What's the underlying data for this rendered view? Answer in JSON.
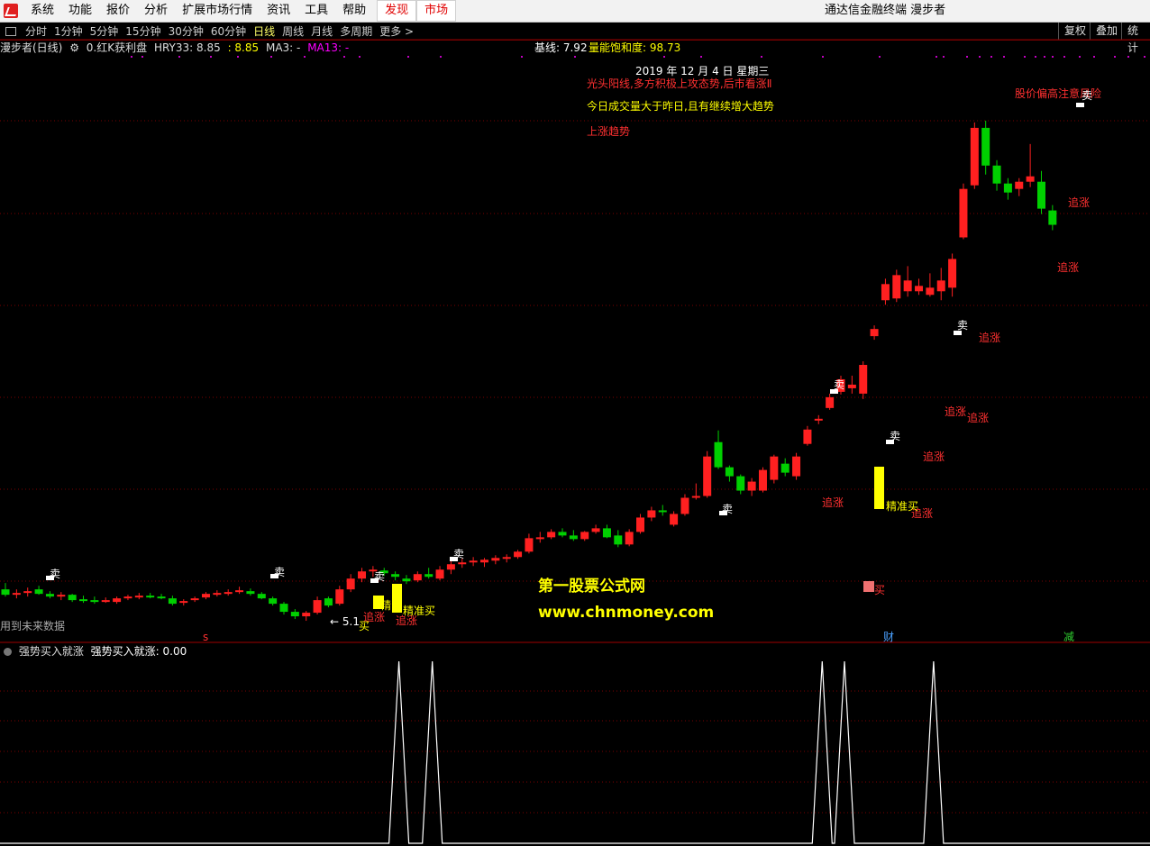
{
  "menu": {
    "items": [
      "系统",
      "功能",
      "报价",
      "分析",
      "扩展市场行情",
      "资讯",
      "工具",
      "帮助"
    ],
    "highlight_items": [
      "发现",
      "市场"
    ],
    "window_title": "通达信金融终端  漫步者"
  },
  "toolbar": {
    "periods": [
      "分时",
      "1分钟",
      "5分钟",
      "15分钟",
      "30分钟",
      "60分钟",
      "日线",
      "周线",
      "月线",
      "多周期",
      "更多 >"
    ],
    "active_period": "日线",
    "right_buttons": [
      "复权",
      "叠加",
      "统计"
    ]
  },
  "chart_header": {
    "stock": "漫步者(日线)",
    "formula": "0.红K获利盘",
    "hry": "HRY33: 8.85",
    "val2": ": 8.85",
    "ma3": "MA3: -",
    "ma13": "MA13: -",
    "base": "基线: 7.92",
    "saturation": "量能饱和度: 98.73"
  },
  "annotations": {
    "date": "2019 年 12 月 4 日 星期三",
    "msg1": "光头阳线,多方积极上攻态势,后市看涨Ⅱ",
    "msg2": "今日成交量大于昨日,且有继续增大趋势",
    "msg3": "上涨趋势",
    "warn": "股价偏高注意风险",
    "future": "用到未来数据",
    "watermark1": "第一股票公式网",
    "watermark2": "www.chnmoney.com",
    "sell": "卖",
    "buy": "买",
    "chase": "追涨",
    "precise_buy": "精准买",
    "jing": "精",
    "arrow_label": "← 5.1",
    "mark_cai": "财",
    "mark_jian": "减",
    "mark_s": "s"
  },
  "sub_header": {
    "label": "强势买入就涨",
    "value": "强势买入就涨: 0.00"
  },
  "colors": {
    "up": "#ff2020",
    "down": "#00d000",
    "grid": "#7a0000",
    "signal": "#ffff00"
  },
  "chart_data": {
    "type": "candlestick",
    "date": "2019-12-04",
    "ohlc": [
      [
        7.38,
        7.45,
        7.3,
        7.32
      ],
      [
        7.33,
        7.38,
        7.28,
        7.34
      ],
      [
        7.34,
        7.4,
        7.3,
        7.36
      ],
      [
        7.38,
        7.42,
        7.32,
        7.33
      ],
      [
        7.33,
        7.36,
        7.28,
        7.3
      ],
      [
        7.31,
        7.35,
        7.26,
        7.32
      ],
      [
        7.32,
        7.33,
        7.24,
        7.26
      ],
      [
        7.27,
        7.31,
        7.23,
        7.26
      ],
      [
        7.26,
        7.3,
        7.22,
        7.24
      ],
      [
        7.25,
        7.29,
        7.23,
        7.26
      ],
      [
        7.24,
        7.3,
        7.22,
        7.28
      ],
      [
        7.28,
        7.32,
        7.26,
        7.3
      ],
      [
        7.3,
        7.34,
        7.27,
        7.31
      ],
      [
        7.31,
        7.34,
        7.28,
        7.29
      ],
      [
        7.3,
        7.33,
        7.27,
        7.28
      ],
      [
        7.28,
        7.31,
        7.2,
        7.22
      ],
      [
        7.23,
        7.27,
        7.2,
        7.25
      ],
      [
        7.26,
        7.3,
        7.24,
        7.28
      ],
      [
        7.29,
        7.35,
        7.27,
        7.33
      ],
      [
        7.33,
        7.37,
        7.3,
        7.34
      ],
      [
        7.34,
        7.38,
        7.31,
        7.35
      ],
      [
        7.35,
        7.41,
        7.33,
        7.37
      ],
      [
        7.36,
        7.39,
        7.31,
        7.33
      ],
      [
        7.33,
        7.35,
        7.27,
        7.28
      ],
      [
        7.28,
        7.3,
        7.2,
        7.22
      ],
      [
        7.22,
        7.24,
        7.1,
        7.13
      ],
      [
        7.13,
        7.16,
        7.05,
        7.08
      ],
      [
        7.08,
        7.14,
        7.03,
        7.12
      ],
      [
        7.12,
        7.3,
        7.1,
        7.26
      ],
      [
        7.28,
        7.3,
        7.18,
        7.2
      ],
      [
        7.22,
        7.42,
        7.2,
        7.38
      ],
      [
        7.38,
        7.55,
        7.35,
        7.5
      ],
      [
        7.5,
        7.62,
        7.46,
        7.58
      ],
      [
        7.58,
        7.64,
        7.52,
        7.6
      ],
      [
        7.59,
        7.62,
        7.53,
        7.56
      ],
      [
        7.55,
        7.58,
        7.48,
        7.52
      ],
      [
        7.5,
        7.54,
        7.44,
        7.47
      ],
      [
        7.48,
        7.58,
        7.46,
        7.55
      ],
      [
        7.55,
        7.62,
        7.5,
        7.52
      ],
      [
        7.5,
        7.64,
        7.48,
        7.6
      ],
      [
        7.6,
        7.7,
        7.55,
        7.66
      ],
      [
        7.66,
        7.72,
        7.62,
        7.68
      ],
      [
        7.68,
        7.74,
        7.64,
        7.7
      ],
      [
        7.68,
        7.73,
        7.63,
        7.71
      ],
      [
        7.7,
        7.76,
        7.66,
        7.73
      ],
      [
        7.72,
        7.77,
        7.68,
        7.74
      ],
      [
        7.74,
        7.82,
        7.72,
        7.8
      ],
      [
        7.8,
        8.0,
        7.78,
        7.95
      ],
      [
        7.95,
        8.02,
        7.9,
        7.96
      ],
      [
        7.96,
        8.05,
        7.94,
        8.02
      ],
      [
        8.02,
        8.06,
        7.96,
        7.98
      ],
      [
        7.98,
        8.04,
        7.92,
        7.94
      ],
      [
        7.94,
        8.03,
        7.92,
        8.02
      ],
      [
        8.02,
        8.1,
        8.0,
        8.06
      ],
      [
        8.06,
        8.1,
        7.95,
        7.96
      ],
      [
        7.98,
        8.04,
        7.85,
        7.88
      ],
      [
        7.88,
        8.05,
        7.86,
        8.02
      ],
      [
        8.02,
        8.22,
        8.0,
        8.18
      ],
      [
        8.18,
        8.3,
        8.14,
        8.26
      ],
      [
        8.26,
        8.32,
        8.2,
        8.24
      ],
      [
        8.1,
        8.25,
        8.08,
        8.22
      ],
      [
        8.22,
        8.44,
        8.2,
        8.4
      ],
      [
        8.41,
        8.56,
        8.38,
        8.42
      ],
      [
        8.42,
        8.92,
        8.4,
        8.86
      ],
      [
        9.02,
        9.15,
        8.72,
        8.74
      ],
      [
        8.74,
        8.76,
        8.58,
        8.64
      ],
      [
        8.64,
        8.66,
        8.44,
        8.48
      ],
      [
        8.48,
        8.62,
        8.42,
        8.58
      ],
      [
        8.48,
        8.74,
        8.46,
        8.71
      ],
      [
        8.6,
        8.88,
        8.56,
        8.86
      ],
      [
        8.78,
        8.84,
        8.64,
        8.68
      ],
      [
        8.64,
        8.9,
        8.6,
        8.86
      ],
      [
        9.0,
        9.2,
        8.98,
        9.16
      ],
      [
        9.26,
        9.32,
        9.22,
        9.28
      ],
      [
        9.4,
        9.56,
        9.38,
        9.52
      ],
      [
        9.58,
        9.76,
        9.55,
        9.72
      ],
      [
        9.62,
        9.76,
        9.56,
        9.66
      ],
      [
        9.56,
        9.92,
        9.5,
        9.88
      ],
      [
        10.2,
        10.32,
        10.16,
        10.28
      ],
      [
        10.6,
        10.84,
        10.55,
        10.78
      ],
      [
        10.62,
        10.94,
        10.58,
        10.88
      ],
      [
        10.7,
        10.98,
        10.64,
        10.82
      ],
      [
        10.7,
        10.84,
        10.66,
        10.76
      ],
      [
        10.66,
        10.9,
        10.64,
        10.74
      ],
      [
        10.7,
        10.96,
        10.6,
        10.82
      ],
      [
        10.74,
        11.12,
        10.64,
        11.06
      ],
      [
        11.3,
        11.9,
        11.28,
        11.84
      ],
      [
        11.88,
        12.58,
        11.84,
        12.52
      ],
      [
        12.52,
        12.6,
        12.0,
        12.1
      ],
      [
        12.1,
        12.16,
        11.82,
        11.9
      ],
      [
        11.9,
        11.96,
        11.72,
        11.8
      ],
      [
        11.84,
        11.96,
        11.76,
        11.92
      ],
      [
        11.92,
        12.34,
        11.86,
        11.98
      ],
      [
        11.92,
        12.04,
        11.56,
        11.62
      ],
      [
        11.6,
        11.66,
        11.38,
        11.44
      ]
    ],
    "signal_series": {
      "name": "强势买入就涨",
      "peaks_at": [
        35,
        38,
        73,
        75,
        83
      ],
      "peak_value": 1,
      "last": 0.0
    }
  }
}
